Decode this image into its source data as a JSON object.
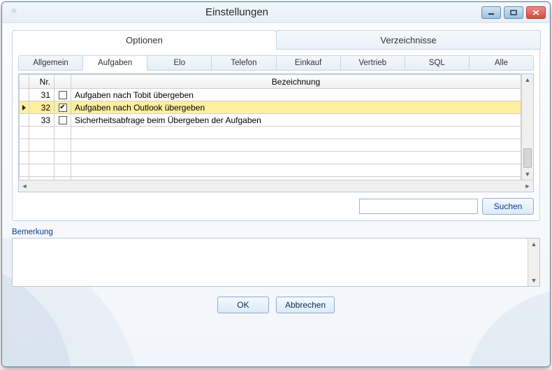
{
  "window": {
    "title": "Einstellungen"
  },
  "mainTabs": {
    "optionen": "Optionen",
    "verzeichnisse": "Verzeichnisse",
    "activeIndex": 0
  },
  "subTabs": {
    "items": [
      "Allgemein",
      "Aufgaben",
      "Elo",
      "Telefon",
      "Einkauf",
      "Vertrieb",
      "SQL",
      "Alle"
    ],
    "activeIndex": 1
  },
  "grid": {
    "headers": {
      "nr": "Nr.",
      "bezeichnung": "Bezeichnung"
    },
    "rows": [
      {
        "nr": "31",
        "checked": false,
        "label": "Aufgaben nach Tobit übergeben",
        "selected": false
      },
      {
        "nr": "32",
        "checked": true,
        "label": "Aufgaben nach Outlook übergeben",
        "selected": true
      },
      {
        "nr": "33",
        "checked": false,
        "label": "Sicherheitsabfrage beim Übergeben der Aufgaben",
        "selected": false
      }
    ]
  },
  "search": {
    "value": "",
    "placeholder": "",
    "buttonLabel": "Suchen"
  },
  "remark": {
    "label": "Bemerkung",
    "value": ""
  },
  "dialogButtons": {
    "ok": "OK",
    "cancel": "Abbrechen"
  }
}
